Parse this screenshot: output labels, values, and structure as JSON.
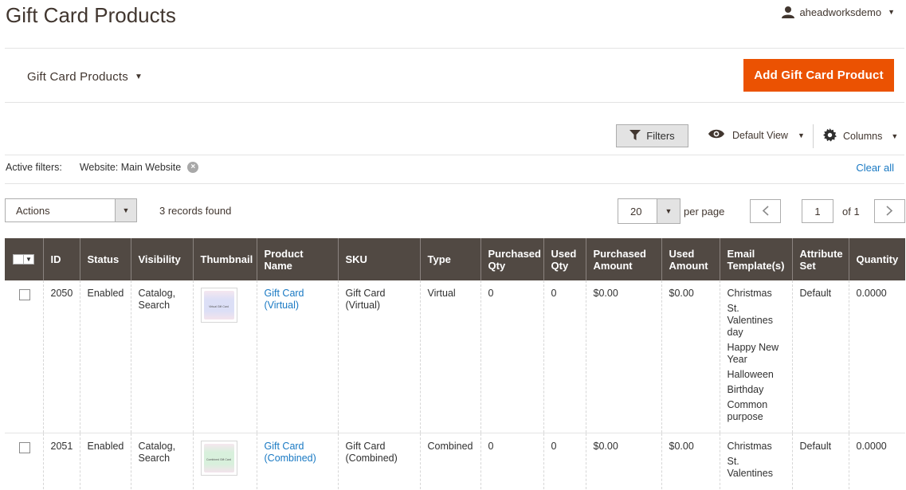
{
  "header": {
    "title": "Gift Card Products",
    "user_name": "aheadworksdemo"
  },
  "toolbar": {
    "switcher_label": "Gift Card Products",
    "add_button_label": "Add Gift Card Product",
    "filters_label": "Filters",
    "view_label": "Default View",
    "columns_label": "Columns"
  },
  "active_filters": {
    "label": "Active filters:",
    "chip": "Website: Main Website",
    "clear_all": "Clear all"
  },
  "grid_controls": {
    "actions_label": "Actions",
    "records_found": "3 records found",
    "per_page_value": "20",
    "per_page_label": "per page",
    "current_page": "1",
    "page_of": "of 1"
  },
  "columns": [
    "ID",
    "Status",
    "Visibility",
    "Thumbnail",
    "Product Name",
    "SKU",
    "Type",
    "Purchased Qty",
    "Used Qty",
    "Purchased Amount",
    "Used Amount",
    "Email Template(s)",
    "Attribute Set",
    "Quantity"
  ],
  "rows": [
    {
      "id": "2050",
      "status": "Enabled",
      "visibility": "Catalog, Search",
      "thumbnail_text": "Virtual Gift Card",
      "product_name": "Gift Card (Virtual)",
      "sku": "Gift Card (Virtual)",
      "type": "Virtual",
      "purchased_qty": "0",
      "used_qty": "0",
      "purchased_amount": "$0.00",
      "used_amount": "$0.00",
      "templates": [
        "Christmas",
        "St. Valentines day",
        "Happy New Year",
        "Halloween",
        "Birthday",
        "Common purpose"
      ],
      "attribute_set": "Default",
      "quantity": "0.0000"
    },
    {
      "id": "2051",
      "status": "Enabled",
      "visibility": "Catalog, Search",
      "thumbnail_text": "Combined Gift Card",
      "product_name": "Gift Card (Combined)",
      "sku": "Gift Card (Combined)",
      "type": "Combined",
      "purchased_qty": "0",
      "used_qty": "0",
      "purchased_amount": "$0.00",
      "used_amount": "$0.00",
      "templates": [
        "Christmas",
        "St. Valentines"
      ],
      "attribute_set": "Default",
      "quantity": "0.0000"
    }
  ],
  "colors": {
    "accent": "#eb5202",
    "header_bg": "#514943",
    "link": "#1979c3"
  },
  "icons": [
    "user-icon",
    "funnel-icon",
    "eye-icon",
    "gear-icon",
    "close-icon",
    "chevron-left-icon",
    "chevron-right-icon"
  ]
}
